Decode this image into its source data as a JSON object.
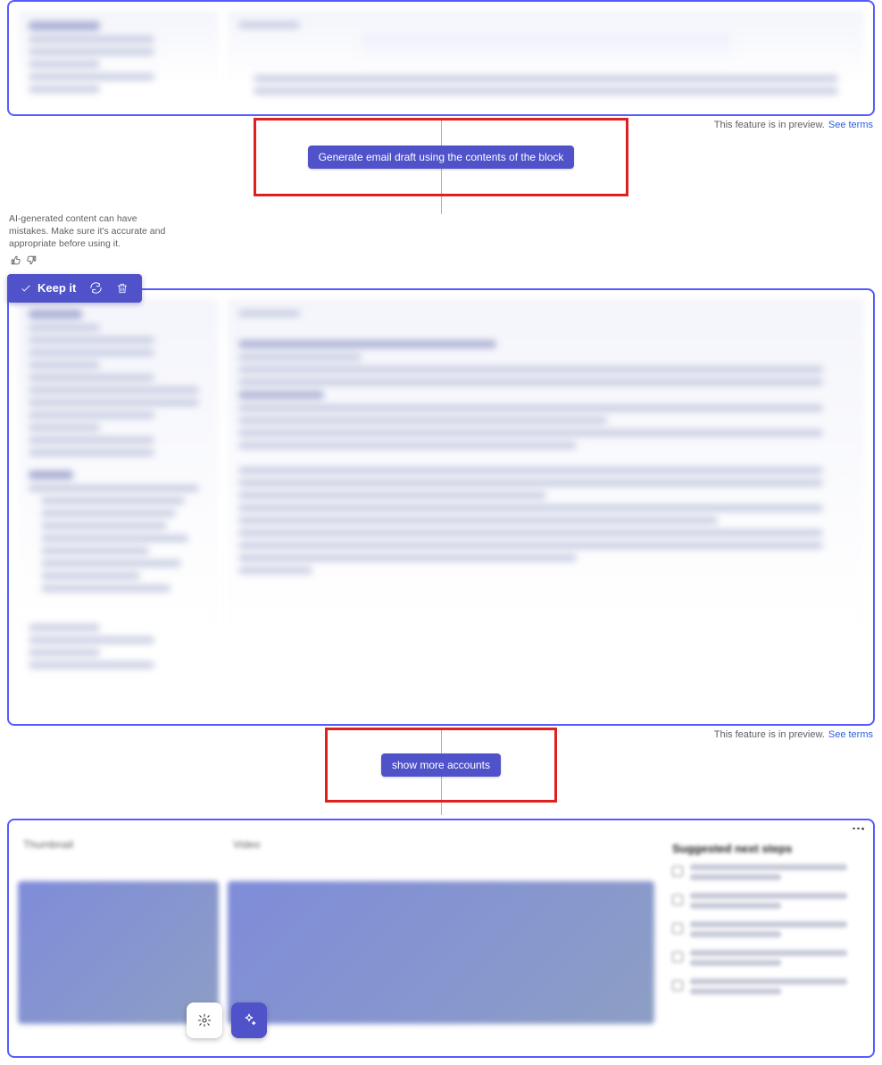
{
  "preview_text": "This feature is in preview.",
  "see_terms": "See terms",
  "prompts": {
    "generate_email": "Generate email draft using the contents of the block",
    "show_more_accounts": "show more accounts"
  },
  "ai_disclaimer": "AI-generated content can have mistakes. Make sure it's accurate and appropriate before using it.",
  "keep_it_label": "Keep it",
  "suggested_title": "Suggested next steps",
  "col_a_head": "Thumbnail",
  "col_b_head": "Video"
}
